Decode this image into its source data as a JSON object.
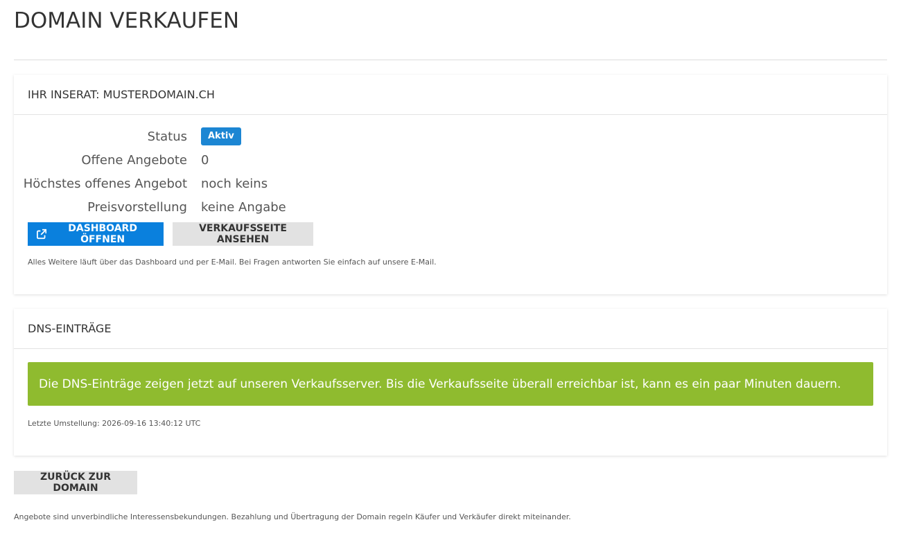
{
  "page": {
    "title": "DOMAIN VERKAUFEN"
  },
  "listing": {
    "heading": "IHR INSERAT: MUSTERDOMAIN.CH",
    "rows": [
      {
        "label": "Status",
        "value": "Aktiv"
      },
      {
        "label": "Offene Angebote",
        "value": "0"
      },
      {
        "label": "Höchstes offenes Angebot",
        "value": "noch keins"
      },
      {
        "label": "Preisvorstellung",
        "value": "keine Angabe"
      }
    ],
    "dashboard_button": "DASHBOARD ÖFFNEN",
    "salespage_button": "VERKAUFSSEITE ANSEHEN",
    "note": "Alles Weitere läuft über das Dashboard und per E-Mail. Bei Fragen antworten Sie einfach auf unsere E-Mail."
  },
  "dns": {
    "heading": "DNS-EINTRÄGE",
    "alert": "Die DNS-Einträge zeigen jetzt auf unseren Verkaufsserver. Bis die Verkaufsseite überall erreichbar ist, kann es ein paar Minuten dauern.",
    "last_change": "Letzte Umstellung: 2026-09-16 13:40:12 UTC"
  },
  "back_button": "ZURÜCK ZUR DOMAIN",
  "footer_note": "Angebote sind unverbindliche Interessensbekundungen. Bezahlung und Übertragung der Domain regeln Käufer und Verkäufer direkt miteinander.",
  "colors": {
    "badge": "#1c86d3",
    "primary_button": "#0a80dd",
    "default_button": "#e2e2e2",
    "success_alert": "#8fbb2f"
  },
  "icons": {
    "dashboard_button": "external-link-icon"
  }
}
